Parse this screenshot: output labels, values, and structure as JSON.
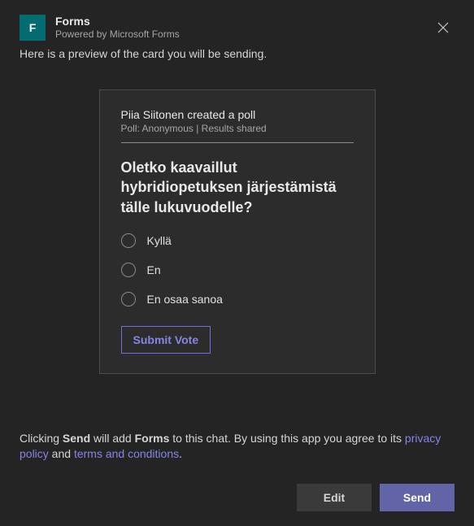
{
  "header": {
    "app_icon_letter": "F",
    "title": "Forms",
    "subtitle": "Powered by Microsoft Forms"
  },
  "preview_text": "Here is a preview of the card you will be sending.",
  "card": {
    "creator_line": "Piia Siitonen created a poll",
    "meta_line": "Poll: Anonymous | Results shared",
    "question": "Oletko kaavaillut hybridiopetuksen järjestämistä tälle lukuvuodelle?",
    "options": [
      {
        "label": "Kyllä"
      },
      {
        "label": "En"
      },
      {
        "label": "En osaa sanoa"
      }
    ],
    "submit_label": "Submit Vote"
  },
  "consent": {
    "t1": "Clicking ",
    "send_bold": "Send",
    "t2": " will add ",
    "forms_bold": "Forms",
    "t3": " to this chat. By using this app you agree to its ",
    "privacy_link": "privacy policy",
    "t4": " and ",
    "terms_link": "terms and conditions",
    "t5": "."
  },
  "buttons": {
    "edit": "Edit",
    "send": "Send"
  }
}
